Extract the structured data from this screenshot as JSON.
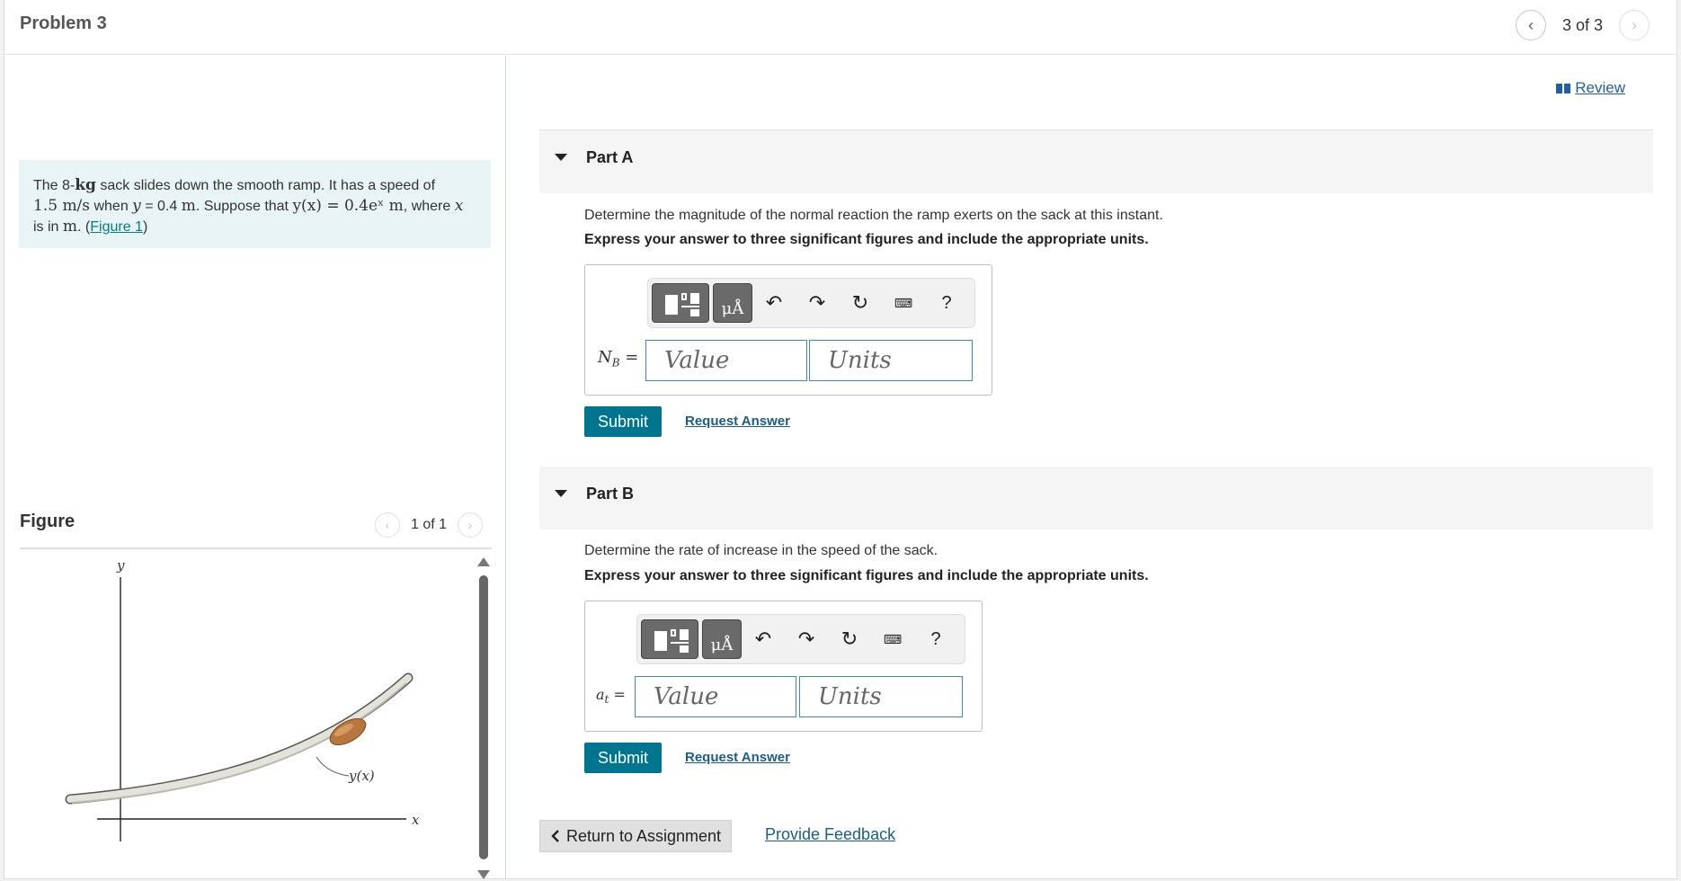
{
  "header": {
    "title": "Problem 3",
    "pager": {
      "text": "3 of 3",
      "prev_icon": "‹",
      "next_icon": "›"
    }
  },
  "prompt": {
    "t1": "The 8-",
    "kg": "kg",
    "t2": " sack slides down the smooth ramp. It has a speed of",
    "speed": "1.5 m/s",
    "t3": " when ",
    "ycond": "y",
    "t4": " = 0.4 ",
    "m1": "m",
    "t5": ". Suppose that ",
    "yfn": "y(x) = 0.4eˣ m",
    "t6": ", where ",
    "xv": "x",
    "t7": "is in ",
    "m2": "m",
    "t8": ". (",
    "figure_link": "Figure 1",
    "t9": ")"
  },
  "figure": {
    "title": "Figure",
    "pager_text": "1 of 1",
    "labels": {
      "y_axis": "y",
      "x_axis": "x",
      "curve": "y(x)"
    }
  },
  "review": {
    "label": "Review"
  },
  "parts": [
    {
      "title": "Part A",
      "question": "Determine the magnitude of the normal reaction the ramp exerts on the sack at this instant.",
      "instruction": "Express your answer to three significant figures and include the appropriate units.",
      "var_main": "N",
      "var_sub": "B",
      "var_eq": " =",
      "value_placeholder": "Value",
      "units_placeholder": "Units",
      "toolbar": {
        "mu": "μÅ",
        "help": "?"
      },
      "submit": "Submit",
      "request": "Request Answer"
    },
    {
      "title": "Part B",
      "question": "Determine the rate of increase in the speed of the sack.",
      "instruction": "Express your answer to three significant figures and include the appropriate units.",
      "var_main": "a",
      "var_sub": "t",
      "var_eq": " =",
      "value_placeholder": "Value",
      "units_placeholder": "Units",
      "toolbar": {
        "mu": "μÅ",
        "help": "?"
      },
      "submit": "Submit",
      "request": "Request Answer"
    }
  ],
  "footer": {
    "return": "Return to Assignment",
    "feedback": "Provide Feedback"
  },
  "colors": {
    "accent": "#00758f",
    "link": "#1a5d8a",
    "prompt_bg": "#e9f5f5",
    "field_border": "#3d87c3"
  }
}
